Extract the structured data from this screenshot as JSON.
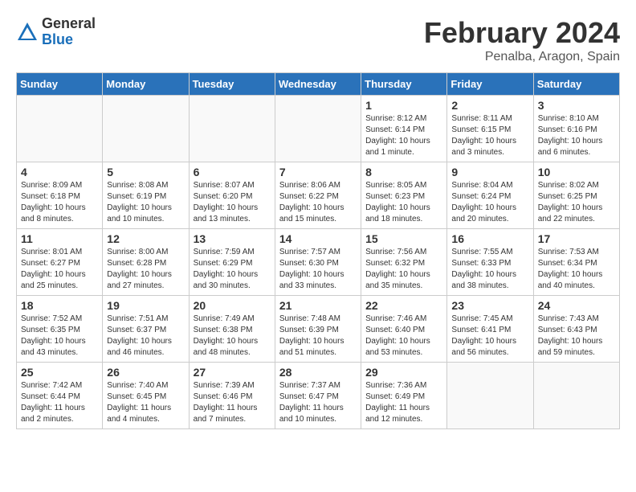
{
  "logo": {
    "general": "General",
    "blue": "Blue"
  },
  "title": {
    "month": "February 2024",
    "location": "Penalba, Aragon, Spain"
  },
  "headers": [
    "Sunday",
    "Monday",
    "Tuesday",
    "Wednesday",
    "Thursday",
    "Friday",
    "Saturday"
  ],
  "weeks": [
    [
      {
        "day": "",
        "info": ""
      },
      {
        "day": "",
        "info": ""
      },
      {
        "day": "",
        "info": ""
      },
      {
        "day": "",
        "info": ""
      },
      {
        "day": "1",
        "info": "Sunrise: 8:12 AM\nSunset: 6:14 PM\nDaylight: 10 hours\nand 1 minute."
      },
      {
        "day": "2",
        "info": "Sunrise: 8:11 AM\nSunset: 6:15 PM\nDaylight: 10 hours\nand 3 minutes."
      },
      {
        "day": "3",
        "info": "Sunrise: 8:10 AM\nSunset: 6:16 PM\nDaylight: 10 hours\nand 6 minutes."
      }
    ],
    [
      {
        "day": "4",
        "info": "Sunrise: 8:09 AM\nSunset: 6:18 PM\nDaylight: 10 hours\nand 8 minutes."
      },
      {
        "day": "5",
        "info": "Sunrise: 8:08 AM\nSunset: 6:19 PM\nDaylight: 10 hours\nand 10 minutes."
      },
      {
        "day": "6",
        "info": "Sunrise: 8:07 AM\nSunset: 6:20 PM\nDaylight: 10 hours\nand 13 minutes."
      },
      {
        "day": "7",
        "info": "Sunrise: 8:06 AM\nSunset: 6:22 PM\nDaylight: 10 hours\nand 15 minutes."
      },
      {
        "day": "8",
        "info": "Sunrise: 8:05 AM\nSunset: 6:23 PM\nDaylight: 10 hours\nand 18 minutes."
      },
      {
        "day": "9",
        "info": "Sunrise: 8:04 AM\nSunset: 6:24 PM\nDaylight: 10 hours\nand 20 minutes."
      },
      {
        "day": "10",
        "info": "Sunrise: 8:02 AM\nSunset: 6:25 PM\nDaylight: 10 hours\nand 22 minutes."
      }
    ],
    [
      {
        "day": "11",
        "info": "Sunrise: 8:01 AM\nSunset: 6:27 PM\nDaylight: 10 hours\nand 25 minutes."
      },
      {
        "day": "12",
        "info": "Sunrise: 8:00 AM\nSunset: 6:28 PM\nDaylight: 10 hours\nand 27 minutes."
      },
      {
        "day": "13",
        "info": "Sunrise: 7:59 AM\nSunset: 6:29 PM\nDaylight: 10 hours\nand 30 minutes."
      },
      {
        "day": "14",
        "info": "Sunrise: 7:57 AM\nSunset: 6:30 PM\nDaylight: 10 hours\nand 33 minutes."
      },
      {
        "day": "15",
        "info": "Sunrise: 7:56 AM\nSunset: 6:32 PM\nDaylight: 10 hours\nand 35 minutes."
      },
      {
        "day": "16",
        "info": "Sunrise: 7:55 AM\nSunset: 6:33 PM\nDaylight: 10 hours\nand 38 minutes."
      },
      {
        "day": "17",
        "info": "Sunrise: 7:53 AM\nSunset: 6:34 PM\nDaylight: 10 hours\nand 40 minutes."
      }
    ],
    [
      {
        "day": "18",
        "info": "Sunrise: 7:52 AM\nSunset: 6:35 PM\nDaylight: 10 hours\nand 43 minutes."
      },
      {
        "day": "19",
        "info": "Sunrise: 7:51 AM\nSunset: 6:37 PM\nDaylight: 10 hours\nand 46 minutes."
      },
      {
        "day": "20",
        "info": "Sunrise: 7:49 AM\nSunset: 6:38 PM\nDaylight: 10 hours\nand 48 minutes."
      },
      {
        "day": "21",
        "info": "Sunrise: 7:48 AM\nSunset: 6:39 PM\nDaylight: 10 hours\nand 51 minutes."
      },
      {
        "day": "22",
        "info": "Sunrise: 7:46 AM\nSunset: 6:40 PM\nDaylight: 10 hours\nand 53 minutes."
      },
      {
        "day": "23",
        "info": "Sunrise: 7:45 AM\nSunset: 6:41 PM\nDaylight: 10 hours\nand 56 minutes."
      },
      {
        "day": "24",
        "info": "Sunrise: 7:43 AM\nSunset: 6:43 PM\nDaylight: 10 hours\nand 59 minutes."
      }
    ],
    [
      {
        "day": "25",
        "info": "Sunrise: 7:42 AM\nSunset: 6:44 PM\nDaylight: 11 hours\nand 2 minutes."
      },
      {
        "day": "26",
        "info": "Sunrise: 7:40 AM\nSunset: 6:45 PM\nDaylight: 11 hours\nand 4 minutes."
      },
      {
        "day": "27",
        "info": "Sunrise: 7:39 AM\nSunset: 6:46 PM\nDaylight: 11 hours\nand 7 minutes."
      },
      {
        "day": "28",
        "info": "Sunrise: 7:37 AM\nSunset: 6:47 PM\nDaylight: 11 hours\nand 10 minutes."
      },
      {
        "day": "29",
        "info": "Sunrise: 7:36 AM\nSunset: 6:49 PM\nDaylight: 11 hours\nand 12 minutes."
      },
      {
        "day": "",
        "info": ""
      },
      {
        "day": "",
        "info": ""
      }
    ]
  ]
}
